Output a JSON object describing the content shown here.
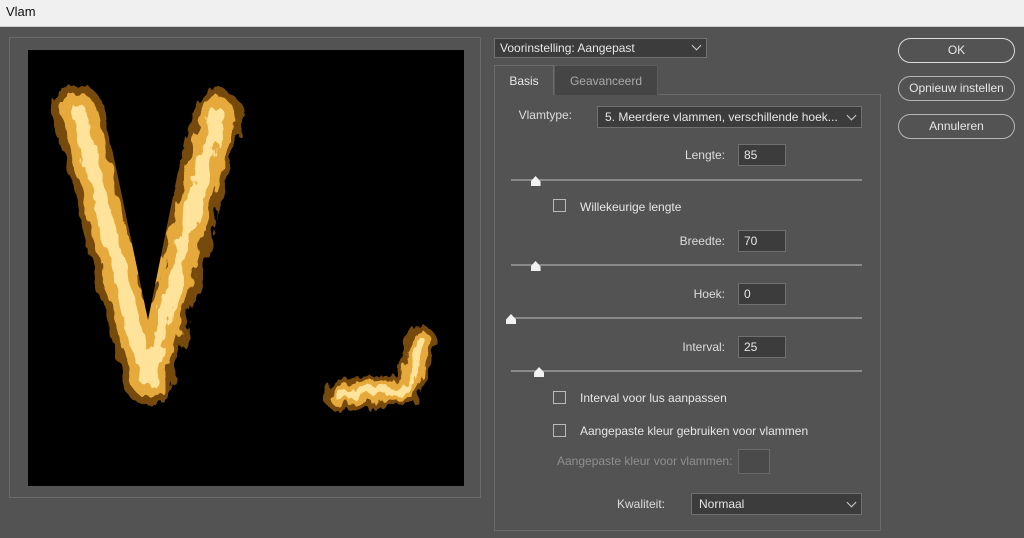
{
  "window": {
    "title": "Vlam"
  },
  "preview": {
    "letter": "V"
  },
  "preset": {
    "label": "Voorinstelling: Aangepast"
  },
  "tabs": [
    {
      "label": "Basis",
      "active": true
    },
    {
      "label": "Geavanceerd",
      "active": false
    }
  ],
  "flame_type": {
    "label": "Vlamtype:",
    "value": "5. Meerdere vlammen, verschillende hoek..."
  },
  "length": {
    "label": "Lengte:",
    "value": "85",
    "slider_fraction": 0.07
  },
  "random_length": {
    "label": "Willekeurige lengte",
    "checked": false
  },
  "width": {
    "label": "Breedte:",
    "value": "70",
    "slider_fraction": 0.07
  },
  "angle": {
    "label": "Hoek:",
    "value": "0",
    "slider_fraction": 0.0
  },
  "interval": {
    "label": "Interval:",
    "value": "25",
    "slider_fraction": 0.08
  },
  "loop_interval": {
    "label": "Interval voor lus aanpassen",
    "checked": false
  },
  "custom_color": {
    "label": "Aangepaste kleur gebruiken voor vlammen",
    "checked": false
  },
  "custom_color_swatch": {
    "label": "Aangepaste kleur voor vlammen:",
    "enabled": false
  },
  "quality": {
    "label": "Kwaliteit:",
    "value": "Normaal"
  },
  "buttons": {
    "ok": "OK",
    "reset": "Opnieuw instellen",
    "cancel": "Annuleren"
  },
  "colors": {
    "dialog_bg": "#535353",
    "flame_core": "#ffe08a",
    "flame_outer": "#e0a830"
  }
}
